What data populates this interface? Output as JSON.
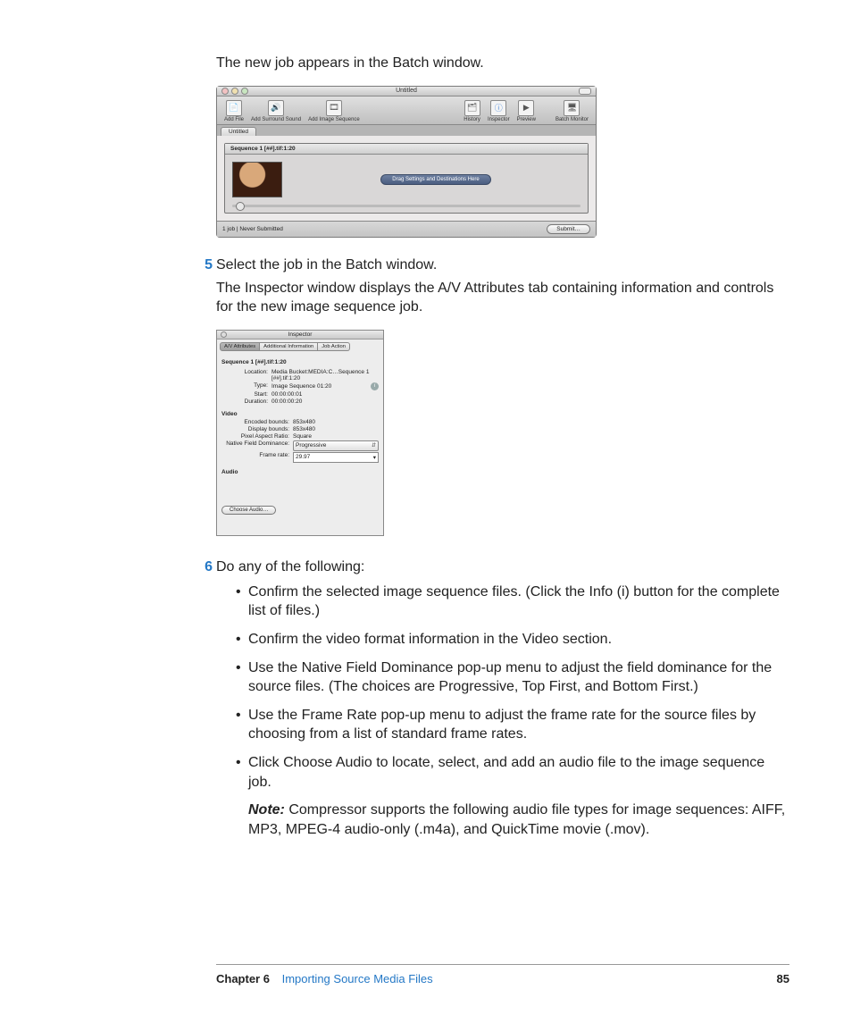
{
  "body": {
    "intro1": "The new job appears in the Batch window.",
    "step5_num": "5",
    "step5_text": "Select the job in the Batch window.",
    "step5_para": "The Inspector window displays the A/V Attributes tab containing information and controls for the new image sequence job.",
    "step6_num": "6",
    "step6_text": "Do any of the following:",
    "bullets": [
      "Confirm the selected image sequence files. (Click the Info (i) button for the complete list of files.)",
      "Confirm the video format information in the Video section.",
      "Use the Native Field Dominance pop-up menu to adjust the field dominance for the source files. (The choices are Progressive, Top First, and Bottom First.)",
      "Use the Frame Rate pop-up menu to adjust the frame rate for the source files by choosing from a list of standard frame rates.",
      "Click Choose Audio to locate, select, and add an audio file to the image sequence job."
    ],
    "note_label": "Note:",
    "note_text": "Compressor supports the following audio file types for image sequences: AIFF, MP3,  MPEG-4 audio-only (.m4a), and QuickTime movie (.mov)."
  },
  "batch": {
    "title": "Untitled",
    "toolbar": {
      "add_file": "Add File",
      "add_surround": "Add Surround Sound",
      "add_imgseq": "Add Image Sequence",
      "history": "History",
      "inspector": "Inspector",
      "preview": "Preview",
      "monitor": "Batch Monitor"
    },
    "tab": "Untitled",
    "job_title": "Sequence 1 [##].tif:1:20",
    "drop_text": "Drag Settings and Destinations Here",
    "status": "1 job   |   Never Submitted",
    "submit": "Submit…"
  },
  "inspector": {
    "title": "Inspector",
    "tabs": {
      "av": "A/V Attributes",
      "addl": "Additional Information",
      "job": "Job Action"
    },
    "seq": "Sequence 1 [##].tif:1:20",
    "fields": {
      "location_k": "Location:",
      "location_v": "Media Bucket:MEDIA:C…Sequence 1 [##].tif:1:20",
      "type_k": "Type:",
      "type_v": "Image Sequence 01:20",
      "start_k": "Start:",
      "start_v": "00:00:00:01",
      "duration_k": "Duration:",
      "duration_v": "00:00:00:20"
    },
    "video_hdr": "Video",
    "video": {
      "enc_k": "Encoded bounds:",
      "enc_v": "853x480",
      "disp_k": "Display bounds:",
      "disp_v": "853x480",
      "par_k": "Pixel Aspect Ratio:",
      "par_v": "Square",
      "nfd_k": "Native Field Dominance:",
      "nfd_v": "Progressive",
      "fr_k": "Frame rate:",
      "fr_v": "29.97"
    },
    "audio_hdr": "Audio",
    "choose_audio": "Choose Audio…"
  },
  "footer": {
    "chapter": "Chapter 6",
    "title": "Importing Source Media Files",
    "page": "85"
  }
}
